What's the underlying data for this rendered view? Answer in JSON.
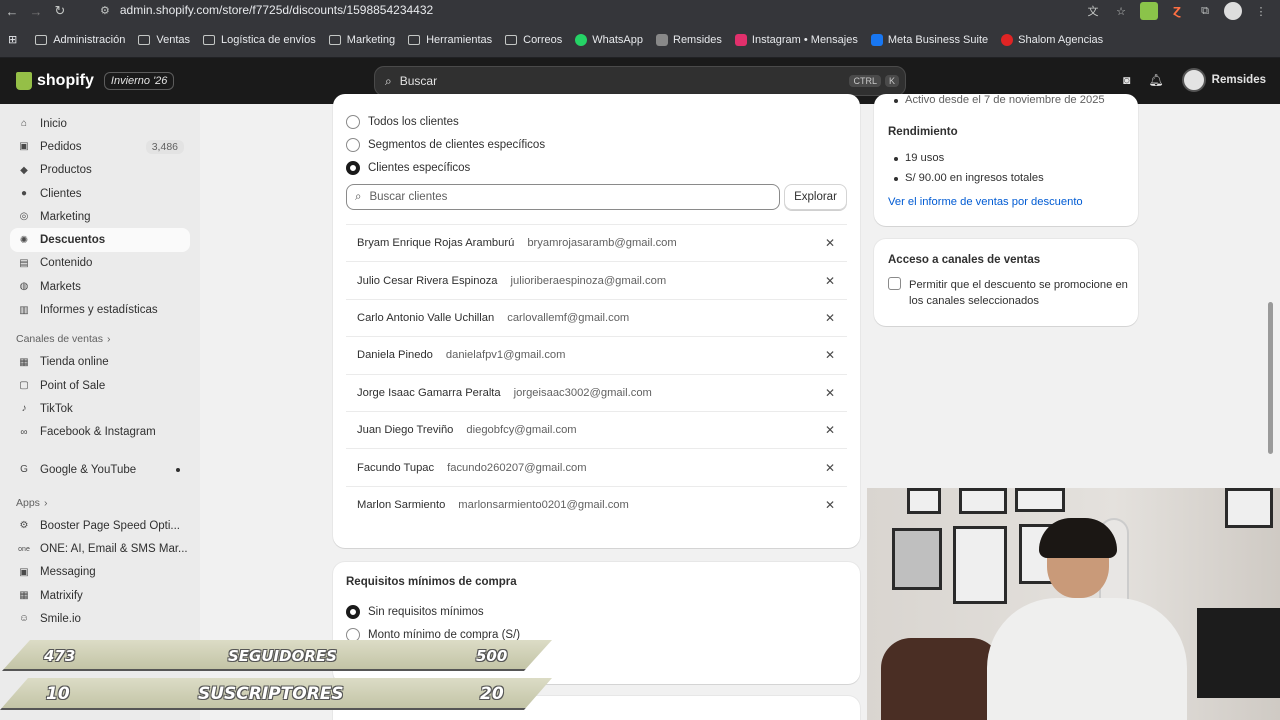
{
  "browser": {
    "url": "admin.shopify.com/store/f7725d/discounts/1598854234432",
    "bookmarks": [
      {
        "label": "Administración",
        "icon": "folder-icon"
      },
      {
        "label": "Ventas",
        "icon": "folder-icon"
      },
      {
        "label": "Logística de envíos",
        "icon": "folder-icon"
      },
      {
        "label": "Marketing",
        "icon": "folder-icon"
      },
      {
        "label": "Herramientas",
        "icon": "folder-icon"
      },
      {
        "label": "Correos",
        "icon": "folder-icon"
      },
      {
        "label": "WhatsApp",
        "icon": "whatsapp-icon",
        "color": "#25d366"
      },
      {
        "label": "Remsides",
        "icon": "remsides-icon",
        "color": "#888888"
      },
      {
        "label": "Instagram • Mensajes",
        "icon": "instagram-icon",
        "color": "#e1306c"
      },
      {
        "label": "Meta Business Suite",
        "icon": "meta-icon",
        "color": "#1877f2"
      },
      {
        "label": "Shalom Agencias",
        "icon": "shalom-icon",
        "color": "#e02424"
      }
    ]
  },
  "topbar": {
    "brand": "shopify",
    "season_badge": "Invierno '26",
    "search_placeholder": "Buscar",
    "shortcut_ctrl": "CTRL",
    "shortcut_k": "K",
    "store_name": "Remsides"
  },
  "sidebar": {
    "items": [
      {
        "label": "Inicio",
        "icon": "home-icon"
      },
      {
        "label": "Pedidos",
        "icon": "orders-icon",
        "count": "3,486"
      },
      {
        "label": "Productos",
        "icon": "tag-icon"
      },
      {
        "label": "Clientes",
        "icon": "person-icon"
      },
      {
        "label": "Marketing",
        "icon": "target-icon"
      },
      {
        "label": "Descuentos",
        "icon": "discount-icon",
        "active": true
      },
      {
        "label": "Contenido",
        "icon": "content-icon"
      },
      {
        "label": "Markets",
        "icon": "globe-icon"
      },
      {
        "label": "Informes y estadísticas",
        "icon": "chart-icon"
      }
    ],
    "sales_channels_title": "Canales de ventas",
    "channels": [
      {
        "label": "Tienda online",
        "icon": "store-icon"
      },
      {
        "label": "Point of Sale",
        "icon": "pos-icon"
      },
      {
        "label": "TikTok",
        "icon": "tiktok-icon"
      },
      {
        "label": "Facebook & Instagram",
        "icon": "meta-icon"
      },
      {
        "label": "Google & YouTube",
        "icon": "google-icon"
      }
    ],
    "apps_title": "Apps",
    "apps": [
      {
        "label": "Booster Page Speed Opti...",
        "icon": "booster-icon"
      },
      {
        "label": "ONE: AI, Email & SMS Mar...",
        "icon": "one-icon"
      },
      {
        "label": "Messaging",
        "icon": "messaging-icon"
      },
      {
        "label": "Matrixify",
        "icon": "matrixify-icon"
      },
      {
        "label": "Smile.io",
        "icon": "smile-icon"
      }
    ]
  },
  "eligibility": {
    "options": [
      "Todos los clientes",
      "Segmentos de clientes específicos",
      "Clientes específicos"
    ],
    "selected_index": 2,
    "search_placeholder": "Buscar clientes",
    "explore_label": "Explorar",
    "customers": [
      {
        "name": "Bryam Enrique Rojas Aramburú",
        "email": "bryamrojasaramb@gmail.com"
      },
      {
        "name": "Julio Cesar Rivera Espinoza",
        "email": "julioriberaespinoza@gmail.com"
      },
      {
        "name": "Carlo Antonio Valle Uchillan",
        "email": "carlovallemf@gmail.com"
      },
      {
        "name": "Daniela Pinedo",
        "email": "danielafpv1@gmail.com"
      },
      {
        "name": "Jorge Isaac Gamarra Peralta",
        "email": "jorgeisaac3002@gmail.com"
      },
      {
        "name": "Juan Diego Treviño",
        "email": "diegobfcy@gmail.com"
      },
      {
        "name": "Facundo Tupac",
        "email": "facundo260207@gmail.com"
      },
      {
        "name": "Marlon Sarmiento",
        "email": "marlonsarmiento0201@gmail.com"
      }
    ]
  },
  "min_requirements": {
    "title": "Requisitos mínimos de compra",
    "options": [
      "Sin requisitos mínimos",
      "Monto mínimo de compra (S/)"
    ],
    "selected_index": 0
  },
  "performance": {
    "cut_text": "Activo desde el 7 de noviembre de 2025",
    "title": "Rendimiento",
    "bullets": [
      "19 usos",
      "S/ 90.00 en ingresos totales"
    ],
    "report_link": "Ver el informe de ventas por descuento"
  },
  "sales_channels": {
    "title": "Acceso a canales de ventas",
    "checkbox_label": "Permitir que el descuento se promocione en los canales seleccionados",
    "checked": false
  },
  "overlay": {
    "followers": {
      "current": "473",
      "label": "SEGUIDORES",
      "goal": "500"
    },
    "subscribers": {
      "current": "10",
      "label": "SUSCRIPTORES",
      "goal": "20"
    }
  }
}
